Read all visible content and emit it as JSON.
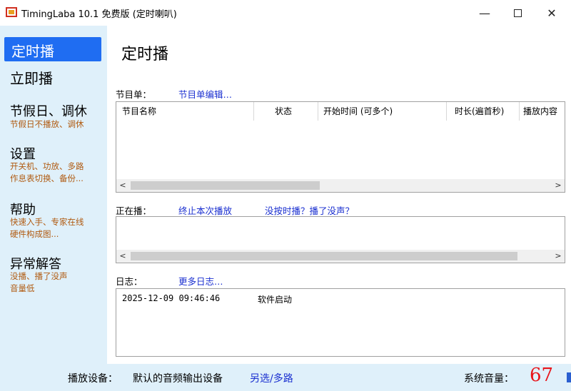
{
  "window": {
    "title": "TimingLaba 10.1 免费版 (定时喇叭)",
    "icons": {
      "app": "app-icon",
      "min": "minimize-icon",
      "max": "maximize-icon",
      "close": "close-icon"
    },
    "min_glyph": "—",
    "close_glyph": "✕"
  },
  "sidebar": {
    "active": "定时播",
    "instant": "立即播",
    "holiday": {
      "title": "节假日、调休",
      "sub": "节假日不播放、调休"
    },
    "settings": {
      "title": "设置",
      "sub": "开关机、功放、多路\n作息表切换、备份..."
    },
    "help": {
      "title": "帮助",
      "sub": "快速入手、专家在线\n硬件构成图..."
    },
    "trouble": {
      "title": "异常解答",
      "sub": "没播、播了没声\n音量低"
    }
  },
  "main": {
    "title": "定时播",
    "program": {
      "label": "节目单：",
      "edit_link": "节目单编辑…",
      "columns": [
        "节目名称",
        "状态",
        "开始时间 (可多个)",
        "时长(遍首秒)",
        "播放内容"
      ]
    },
    "playing": {
      "label": "正在播：",
      "stop_link": "终止本次播放",
      "why_link": "没按时播？播了没声？"
    },
    "log": {
      "label": "日志：",
      "more_link": "更多日志…",
      "entries": [
        {
          "time": "2025-12-09 09:46:46",
          "message": "软件启动"
        }
      ]
    },
    "scroll": {
      "left": "<",
      "right": ">"
    }
  },
  "status": {
    "device_label": "播放设备：",
    "device_value": "默认的音频输出设备",
    "alt_link": "另选/多路",
    "volume_label": "系统音量：",
    "volume_value": "67"
  },
  "colors": {
    "accent": "#1f6df2",
    "sidebar_bg": "#dff0fa",
    "link": "#1a2fd0",
    "sub_text": "#b05a10",
    "volume": "#e8141a"
  }
}
